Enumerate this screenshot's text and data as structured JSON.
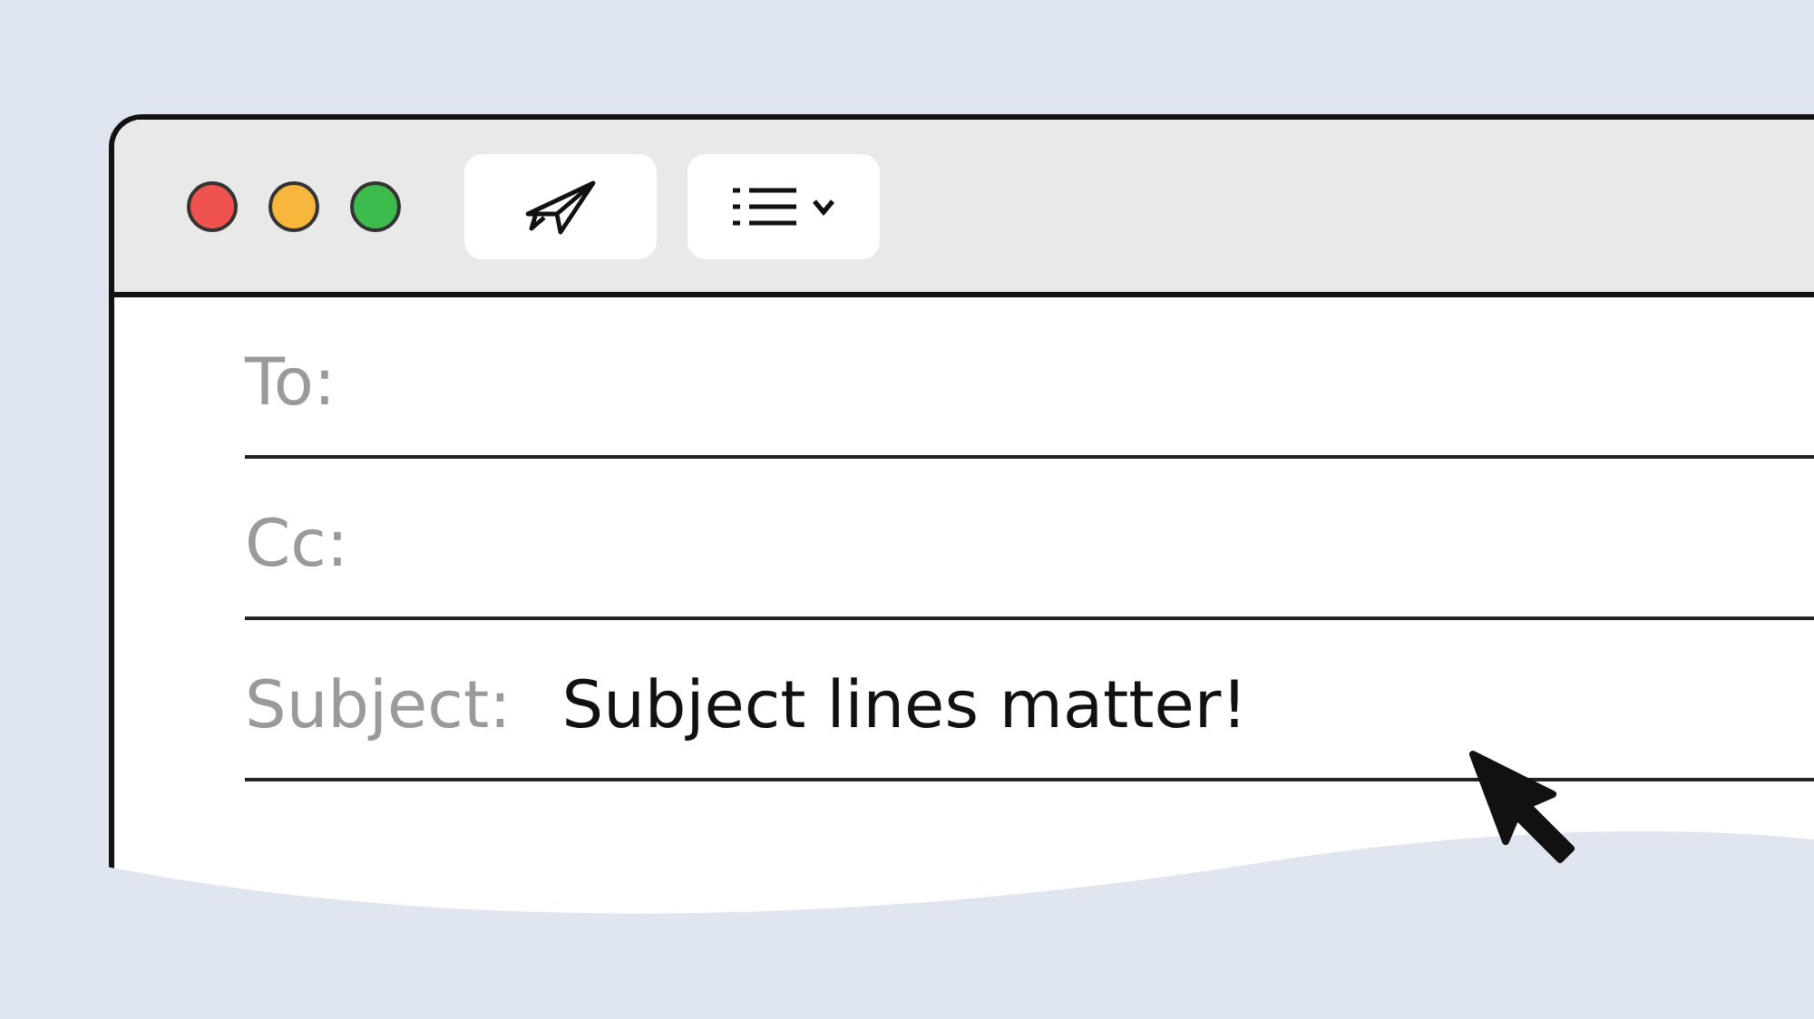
{
  "fields": [
    {
      "label": "To:"
    },
    {
      "label": "Cc:"
    },
    {
      "label": "Subject:",
      "value": "Subject lines matter!"
    }
  ]
}
